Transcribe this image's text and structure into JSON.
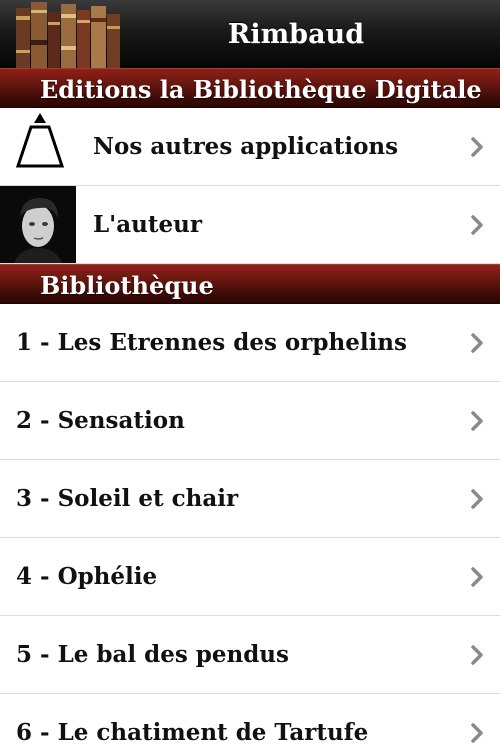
{
  "navbar": {
    "title": "Rimbaud",
    "icons": {
      "books": "books-shelf-icon"
    }
  },
  "sections": [
    {
      "header": "Editions la Bibliothèque Digitale",
      "items": [
        {
          "label": "Nos autres applications",
          "icon": "pyramid-logo-icon"
        },
        {
          "label": "L'auteur",
          "icon": "author-portrait-icon"
        }
      ]
    },
    {
      "header": "Bibliothèque",
      "items": [
        {
          "label": "1 - Les Etrennes des orphelins"
        },
        {
          "label": "2 - Sensation"
        },
        {
          "label": "3 - Soleil et chair"
        },
        {
          "label": "4 - Ophélie"
        },
        {
          "label": "5 - Le bal des pendus"
        },
        {
          "label": "6 - Le chatiment de Tartufe"
        }
      ]
    }
  ],
  "colors": {
    "navbar": "#1a1a1a",
    "section_header": "#6b1810",
    "chevron": "#8a8a8a",
    "row_text": "#111111"
  }
}
